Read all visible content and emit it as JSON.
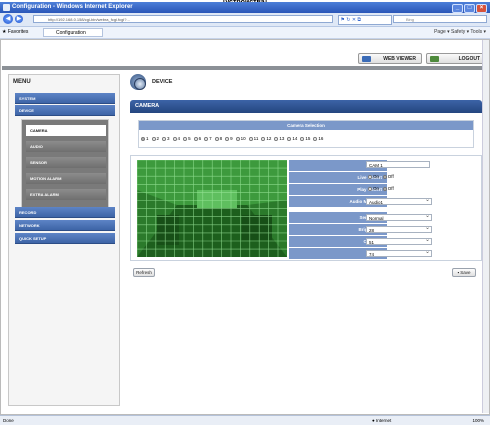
{
  "caption": "[устройства]",
  "window": {
    "title": "Configuration - Windows Internet Explorer"
  },
  "address": {
    "url": "http://192.168.0.158/cgi-bin/webra_fcgi.fcgi?...",
    "host_display": "192.168.0.158"
  },
  "search": {
    "placeholder": "Bing"
  },
  "favorites": {
    "label": "Favorites",
    "tab": "Configuration",
    "tools": "Page ▾  Safety ▾  Tools ▾"
  },
  "topbar": {
    "web_viewer": "WEB VIEWER",
    "logout": "LOGOUT"
  },
  "menu": {
    "title": "MENU",
    "items": [
      "SYSTEM",
      "DEVICE",
      "RECORD",
      "NETWORK",
      "QUICK SETUP"
    ],
    "device_sub": [
      "CAMERA",
      "AUDIO",
      "SENSOR",
      "MOTION ALARM",
      "EXTRA ALARM"
    ]
  },
  "page": {
    "section": "DEVICE",
    "panel": "CAMERA"
  },
  "camera_selection": {
    "heading": "Camera Selection",
    "options": [
      "1",
      "2",
      "3",
      "4",
      "5",
      "6",
      "7",
      "8",
      "9",
      "10",
      "11",
      "12",
      "13",
      "14",
      "15",
      "16"
    ],
    "selected": "1"
  },
  "settings": {
    "title_label": "Title",
    "title_value": "CAM 1",
    "live_covert_label": "Live Covert",
    "play_covert_label": "Play Covert",
    "on": "On",
    "off": "Off",
    "audio_mapping_label": "Audio Mapping",
    "audio_mapping_value": "Audio1",
    "sensitivity_label": "Sensitivity",
    "sensitivity_value": "Normal",
    "brightness_label": "Brightness",
    "brightness_value": "28",
    "contrast_label": "Contrast",
    "contrast_value": "51",
    "color_label": "Color",
    "color_value": "74"
  },
  "buttons": {
    "refresh": "Refresh",
    "save": "Save"
  },
  "status": {
    "left": "Done",
    "zone": "Internet",
    "zoom": "100%"
  }
}
